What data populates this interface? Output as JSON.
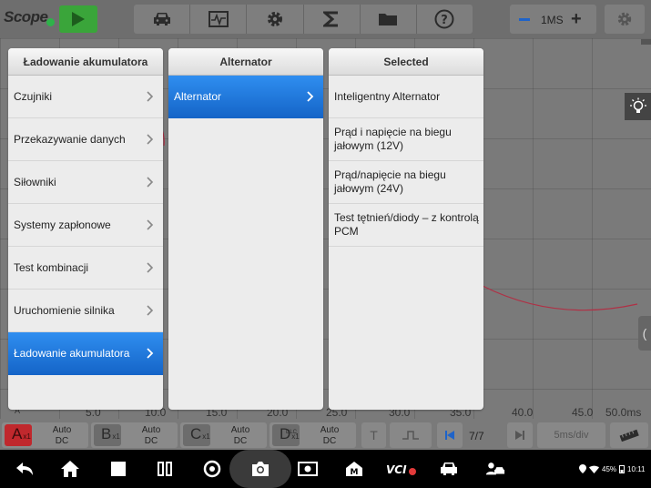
{
  "topbar": {
    "app_title": "Scope",
    "icons": [
      "play-icon",
      "car-icon",
      "waveform-icon",
      "gear-icon",
      "sigma-icon",
      "folder-icon",
      "help-icon"
    ],
    "timebase_label": "1MS"
  },
  "scope": {
    "axis_labels": [
      "5.0",
      "10.0",
      "15.0",
      "20.0",
      "25.0",
      "30.0",
      "35.0",
      "40.0",
      "45.0",
      "50.0ms"
    ],
    "channel_marker": "A",
    "trace_color": "#b03045"
  },
  "panels": {
    "category": {
      "header": "Ładowanie akumulatora",
      "items": [
        {
          "label": "Czujniki"
        },
        {
          "label": "Przekazywanie danych"
        },
        {
          "label": "Siłowniki"
        },
        {
          "label": "Systemy zapłonowe"
        },
        {
          "label": "Test kombinacji"
        },
        {
          "label": "Uruchomienie silnika"
        },
        {
          "label": "Ładowanie akumulatora"
        }
      ]
    },
    "subcategory": {
      "header": "Alternator",
      "items": [
        {
          "label": "Alternator"
        }
      ]
    },
    "selected": {
      "header": "Selected",
      "items": [
        {
          "label": "Inteligentny Alternator"
        },
        {
          "label": "Prąd i napięcie na biegu jałowym (12V)"
        },
        {
          "label": "Prąd/napięcie na biegu jałowym (24V)"
        },
        {
          "label": "Test tętnień/diody – z kontrolą PCM"
        }
      ]
    }
  },
  "channels": [
    {
      "letter": "A",
      "sub": "x1",
      "coupling_1": "Auto",
      "coupling_2": "DC"
    },
    {
      "letter": "B",
      "sub": "x1",
      "coupling_1": "Auto",
      "coupling_2": "DC"
    },
    {
      "letter": "C",
      "sub": "x1",
      "coupling_1": "Auto",
      "coupling_2": "DC"
    },
    {
      "letter": "D",
      "sub": "x1",
      "tag": "DLC",
      "coupling_1": "Auto",
      "coupling_2": "DC"
    }
  ],
  "chanbar": {
    "trigger_label": "T",
    "page": "7/7",
    "time_div": "5ms/div"
  },
  "status": {
    "battery": "45%",
    "time": "10:11"
  },
  "colors": {
    "accent": "#1e78e0",
    "channel_a": "#c0282d",
    "play": "#3aa53a"
  }
}
